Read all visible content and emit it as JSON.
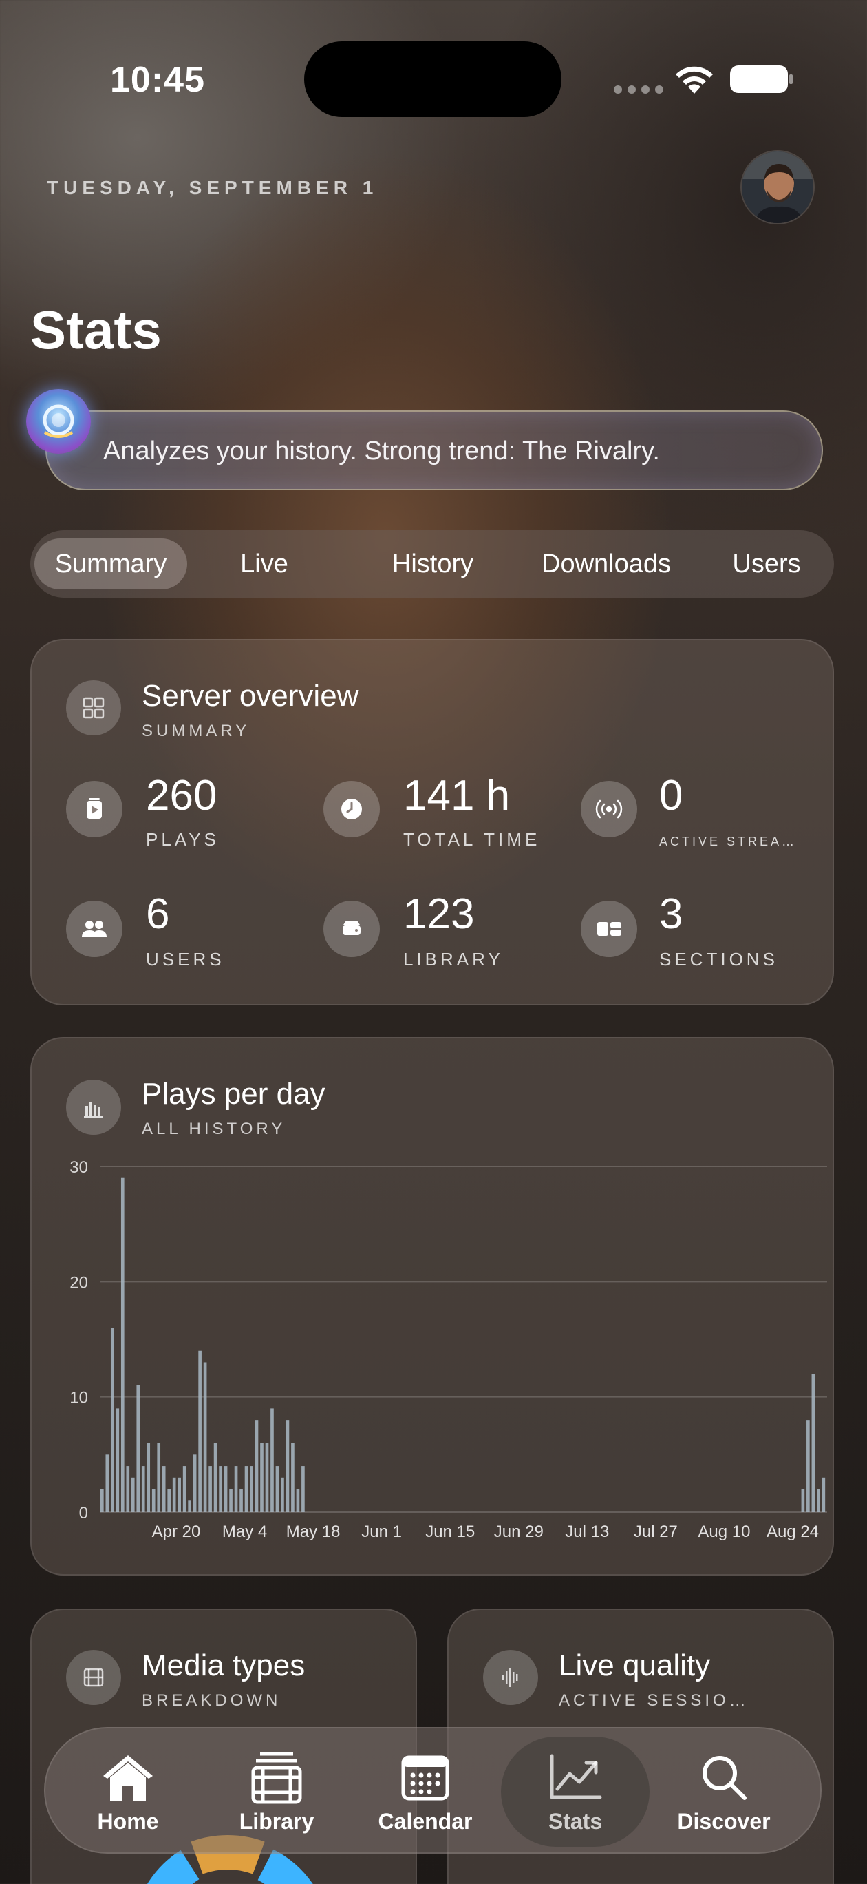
{
  "status_bar": {
    "time": "10:45"
  },
  "header": {
    "date": "TUESDAY, SEPTEMBER 1",
    "title": "Stats"
  },
  "ai_banner": {
    "text": "Analyzes your history. Strong trend: The Rivalry."
  },
  "tabs": [
    {
      "label": "Summary",
      "active": true
    },
    {
      "label": "Live",
      "active": false
    },
    {
      "label": "History",
      "active": false
    },
    {
      "label": "Downloads",
      "active": false
    },
    {
      "label": "Users",
      "active": false
    }
  ],
  "server_overview": {
    "title": "Server overview",
    "subtitle": "SUMMARY",
    "stats": [
      {
        "value": "260",
        "label": "PLAYS",
        "icon": "play-icon"
      },
      {
        "value": "141 h",
        "label": "TOTAL TIME",
        "icon": "clock-icon"
      },
      {
        "value": "0",
        "label": "ACTIVE STREA…",
        "icon": "broadcast-icon"
      },
      {
        "value": "6",
        "label": "USERS",
        "icon": "users-icon"
      },
      {
        "value": "123",
        "label": "LIBRARY",
        "icon": "drive-icon"
      },
      {
        "value": "3",
        "label": "SECTIONS",
        "icon": "sections-icon"
      }
    ]
  },
  "plays_per_day": {
    "title": "Plays per day",
    "subtitle": "ALL HISTORY"
  },
  "chart_data": {
    "type": "bar",
    "title": "Plays per day",
    "subtitle": "ALL HISTORY",
    "xlabel": "",
    "ylabel": "",
    "ylim": [
      0,
      30
    ],
    "y_ticks": [
      0,
      10,
      20,
      30
    ],
    "x_ticks": [
      "Apr 20",
      "May 4",
      "May 18",
      "Jun 1",
      "Jun 15",
      "Jun 29",
      "Jul 13",
      "Jul 27",
      "Aug 10",
      "Aug 24"
    ],
    "grid": true,
    "bar_color": "#a9b8c4",
    "series": [
      {
        "values": [
          2,
          5,
          16,
          9,
          29,
          4,
          3,
          11,
          4,
          6,
          2,
          6,
          4,
          2,
          3,
          3,
          4,
          1,
          5,
          14,
          13,
          4,
          6,
          4,
          4,
          2,
          4,
          2,
          4,
          4,
          8,
          6,
          6,
          9,
          4,
          3,
          8,
          6,
          2,
          4,
          0,
          0,
          0,
          0,
          0,
          0,
          0,
          0,
          0,
          0,
          0,
          0,
          0,
          0,
          0,
          0,
          0,
          0,
          0,
          0,
          0,
          0,
          0,
          0,
          0,
          0,
          0,
          0,
          0,
          0,
          0,
          0,
          0,
          0,
          0,
          0,
          0,
          0,
          0,
          0,
          0,
          0,
          0,
          0,
          0,
          0,
          0,
          0,
          0,
          0,
          0,
          0,
          0,
          0,
          0,
          0,
          0,
          0,
          0,
          0,
          0,
          0,
          0,
          0,
          0,
          0,
          0,
          0,
          0,
          0,
          0,
          0,
          0,
          0,
          0,
          0,
          0,
          0,
          0,
          0,
          0,
          0,
          0,
          0,
          0,
          0,
          0,
          0,
          0,
          0,
          0,
          0,
          0,
          0,
          0,
          0,
          2,
          8,
          12,
          2,
          3
        ]
      }
    ]
  },
  "media_types": {
    "title": "Media types",
    "subtitle": "BREAKDOWN"
  },
  "live_quality": {
    "title": "Live quality",
    "subtitle": "ACTIVE SESSIO…"
  },
  "bottom_nav": [
    {
      "label": "Home",
      "icon": "home-icon",
      "active": false
    },
    {
      "label": "Library",
      "icon": "library-icon",
      "active": false
    },
    {
      "label": "Calendar",
      "icon": "calendar-icon",
      "active": false
    },
    {
      "label": "Stats",
      "icon": "stats-icon",
      "active": true
    },
    {
      "label": "Discover",
      "icon": "search-icon",
      "active": false
    }
  ]
}
